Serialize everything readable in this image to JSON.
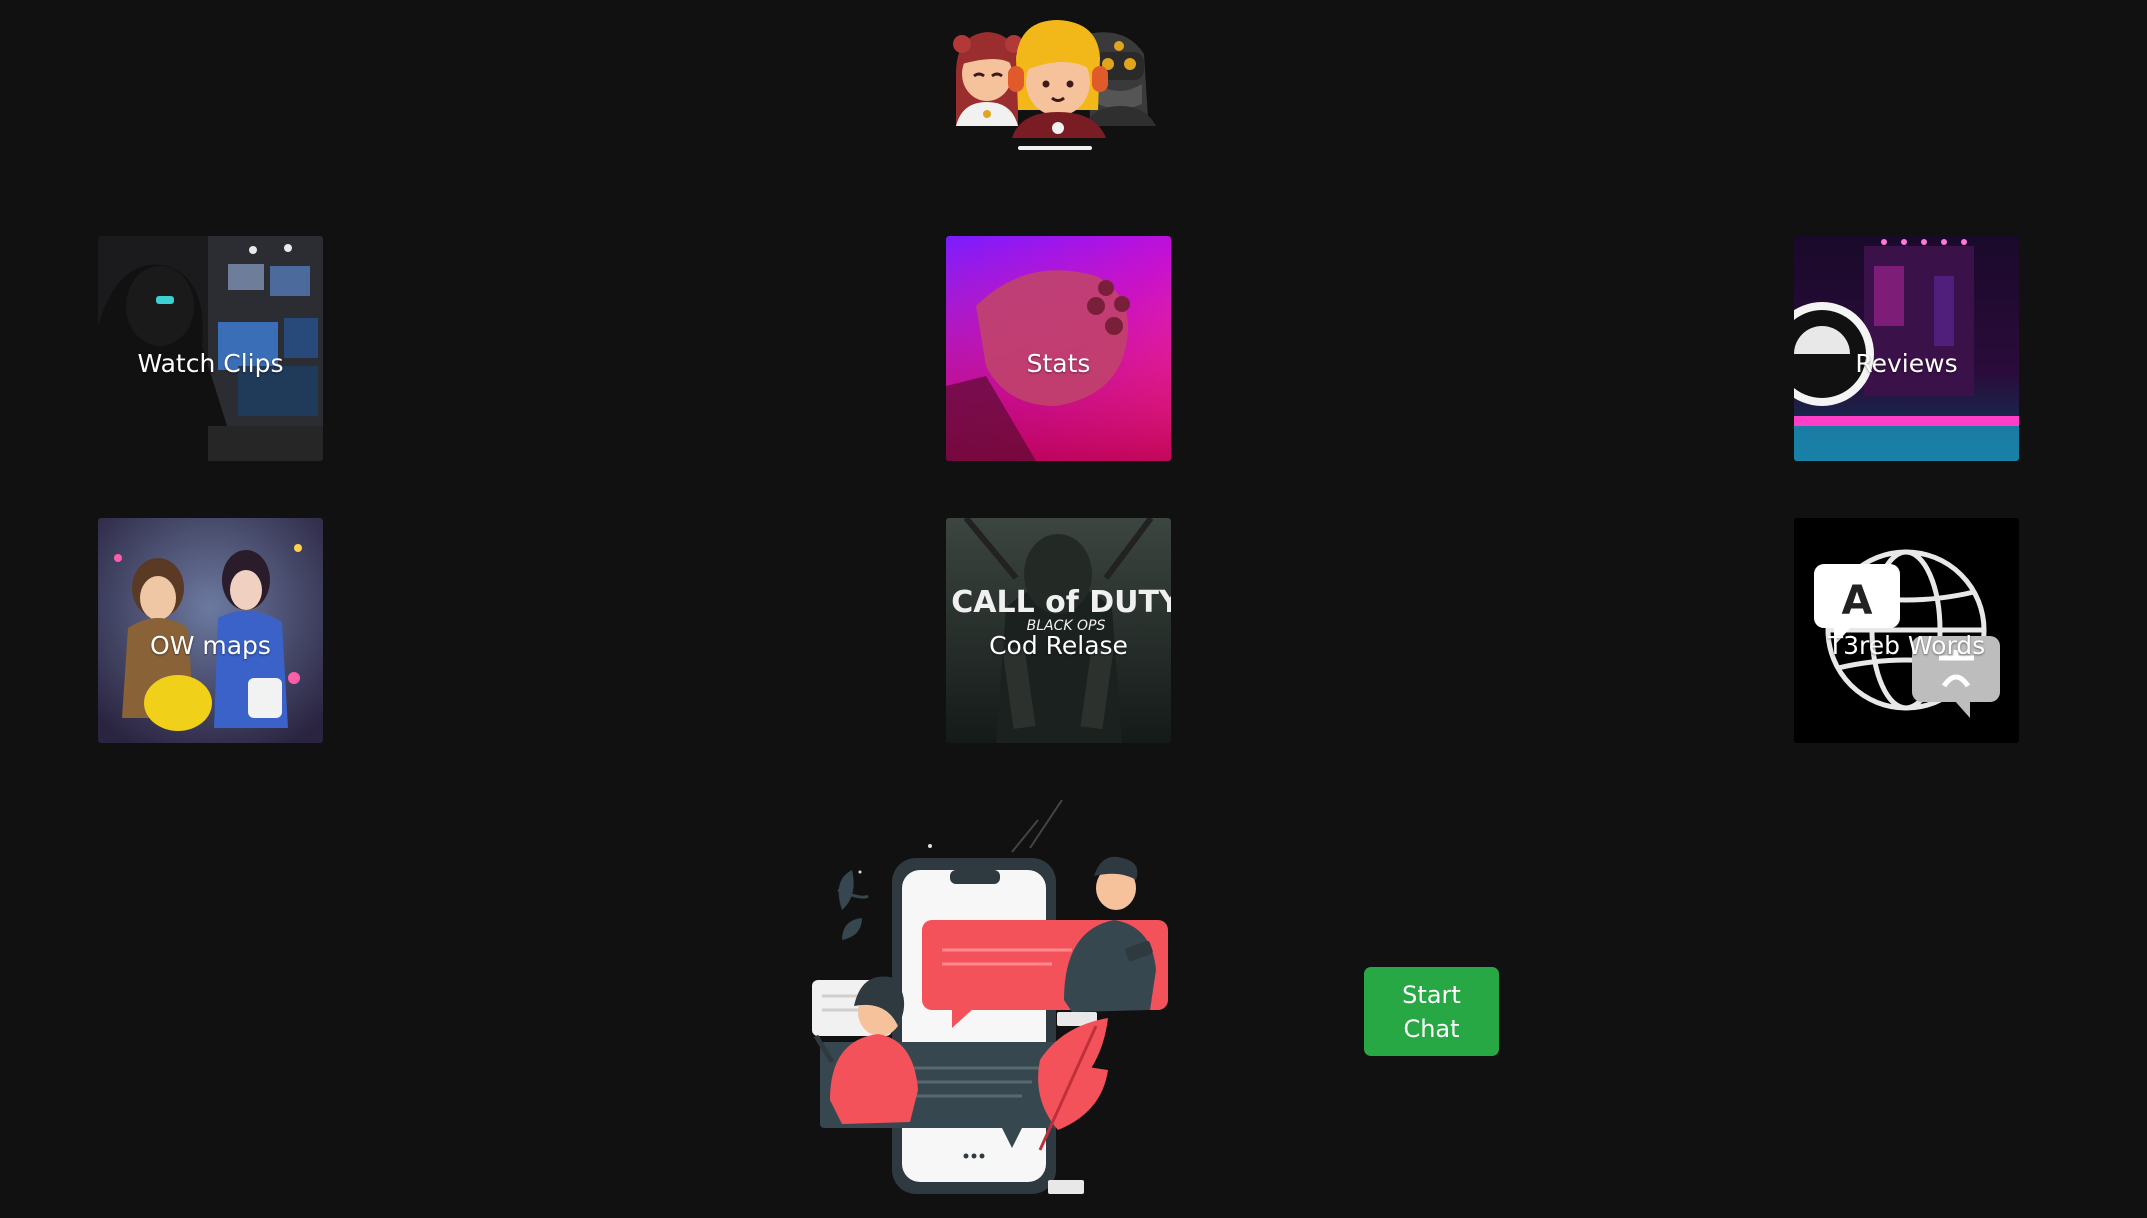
{
  "logo": {
    "icon": "gamers-group-icon"
  },
  "tiles": [
    {
      "label": "Watch Clips",
      "icon": "gamer-at-pc-image"
    },
    {
      "label": "Stats",
      "icon": "gamepad-neon-image"
    },
    {
      "label": "Reviews",
      "icon": "gaming-setup-image"
    },
    {
      "label": "OW maps",
      "icon": "overwatch-heroes-image"
    },
    {
      "label": "Cod Relase",
      "icon": "cod-black-ops-image",
      "art_text": {
        "line1": "CALL of DUTY",
        "line2": "BLACK OPS"
      }
    },
    {
      "label": "T3reb Words",
      "icon": "translate-globe-image",
      "art_text": {
        "glyph": "A"
      }
    }
  ],
  "chat": {
    "illustration": "chat-conversation-illustration",
    "button_label": "Start Chat"
  },
  "colors": {
    "background": "#111111",
    "button": "#28a745",
    "text": "#ffffff"
  }
}
